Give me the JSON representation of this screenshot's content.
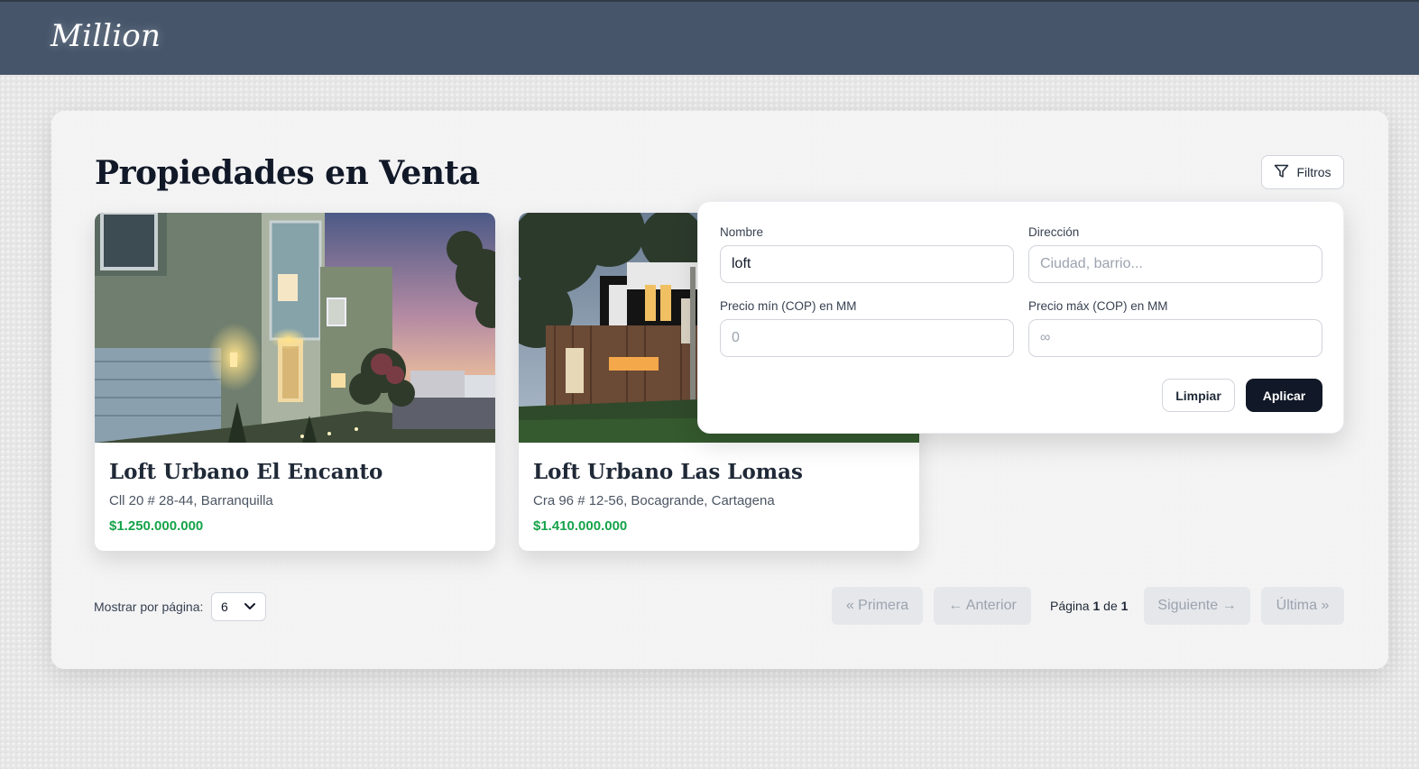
{
  "header": {
    "brand": "Million"
  },
  "main": {
    "title": "Propiedades en Venta",
    "filters_button": "Filtros"
  },
  "properties": [
    {
      "name": "Loft Urbano El Encanto",
      "address": "Cll 20 # 28-44, Barranquilla",
      "price": "$1.250.000.000"
    },
    {
      "name": "Loft Urbano Las Lomas",
      "address": "Cra 96 # 12-56, Bocagrande, Cartagena",
      "price": "$1.410.000.000"
    }
  ],
  "filters": {
    "name_label": "Nombre",
    "name_value": "loft",
    "address_label": "Dirección",
    "address_placeholder": "Ciudad, barrio...",
    "price_min_label": "Precio mín (COP) en MM",
    "price_min_placeholder": "0",
    "price_max_label": "Precio máx (COP) en MM",
    "price_max_placeholder": "∞",
    "clear_label": "Limpiar",
    "apply_label": "Aplicar"
  },
  "pagination": {
    "per_page_label": "Mostrar por página:",
    "per_page_value": "6",
    "first": "« Primera",
    "prev": "← Anterior",
    "page_word": "Página",
    "current_page": "1",
    "of_word": "de",
    "total_pages": "1",
    "next": "Siguiente →",
    "last": "Última »"
  },
  "colors": {
    "header_bg": "#46556a",
    "price": "#16a34a",
    "apply_bg": "#111827"
  },
  "icons": {
    "filter": "filter-funnel-icon",
    "select": "chevron-down-icon"
  }
}
